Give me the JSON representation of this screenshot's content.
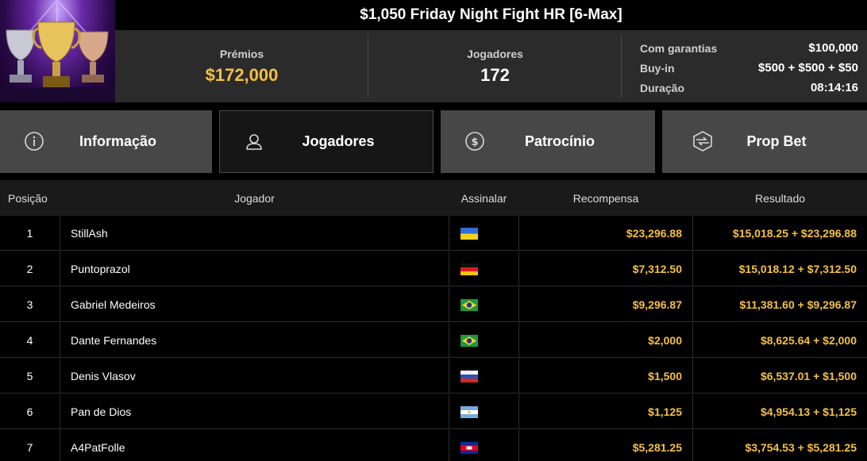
{
  "header": {
    "title": "$1,050 Friday Night Fight HR [6-Max]",
    "image": "trophy-cups-image",
    "prize_label": "Prémios",
    "prize_value": "$172,000",
    "players_label": "Jogadores",
    "players_value": "172",
    "details": [
      {
        "key": "Com garantias",
        "value": "$100,000"
      },
      {
        "key": "Buy-in",
        "value": "$500 + $500 + $50"
      },
      {
        "key": "Duração",
        "value": "08:14:16"
      }
    ]
  },
  "tabs": [
    {
      "label": "Informação",
      "icon": "info-icon",
      "active": false
    },
    {
      "label": "Jogadores",
      "icon": "user-icon",
      "active": true
    },
    {
      "label": "Patrocínio",
      "icon": "dollar-coin-icon",
      "active": false
    },
    {
      "label": "Prop Bet",
      "icon": "prop-bet-icon",
      "active": false
    }
  ],
  "table": {
    "columns": [
      "Posição",
      "Jogador",
      "Assinalar",
      "Recompensa",
      "Resultado"
    ],
    "rows": [
      {
        "pos": "1",
        "name": "StillAsh",
        "flag": "ukraine",
        "reward": "$23,296.88",
        "result": "$15,018.25 + $23,296.88"
      },
      {
        "pos": "2",
        "name": "Puntoprazol",
        "flag": "germany",
        "reward": "$7,312.50",
        "result": "$15,018.12 + $7,312.50"
      },
      {
        "pos": "3",
        "name": "Gabriel Medeiros",
        "flag": "brazil",
        "reward": "$9,296.87",
        "result": "$11,381.60 + $9,296.87"
      },
      {
        "pos": "4",
        "name": "Dante Fernandes",
        "flag": "brazil",
        "reward": "$2,000",
        "result": "$8,625.64 + $2,000"
      },
      {
        "pos": "5",
        "name": "Denis Vlasov",
        "flag": "russia",
        "reward": "$1,500",
        "result": "$6,537.01 + $1,500"
      },
      {
        "pos": "6",
        "name": "Pan de Dios",
        "flag": "argentina",
        "reward": "$1,125",
        "result": "$4,954.13 + $1,125"
      },
      {
        "pos": "7",
        "name": "A4PatFolle",
        "flag": "cambodia",
        "reward": "$5,281.25",
        "result": "$3,754.53 + $5,281.25"
      }
    ]
  },
  "colors": {
    "gold": "#f5c044",
    "tab_bg": "#474747",
    "tab_active_bg": "#161616",
    "info_bg": "#2b2b2b"
  }
}
